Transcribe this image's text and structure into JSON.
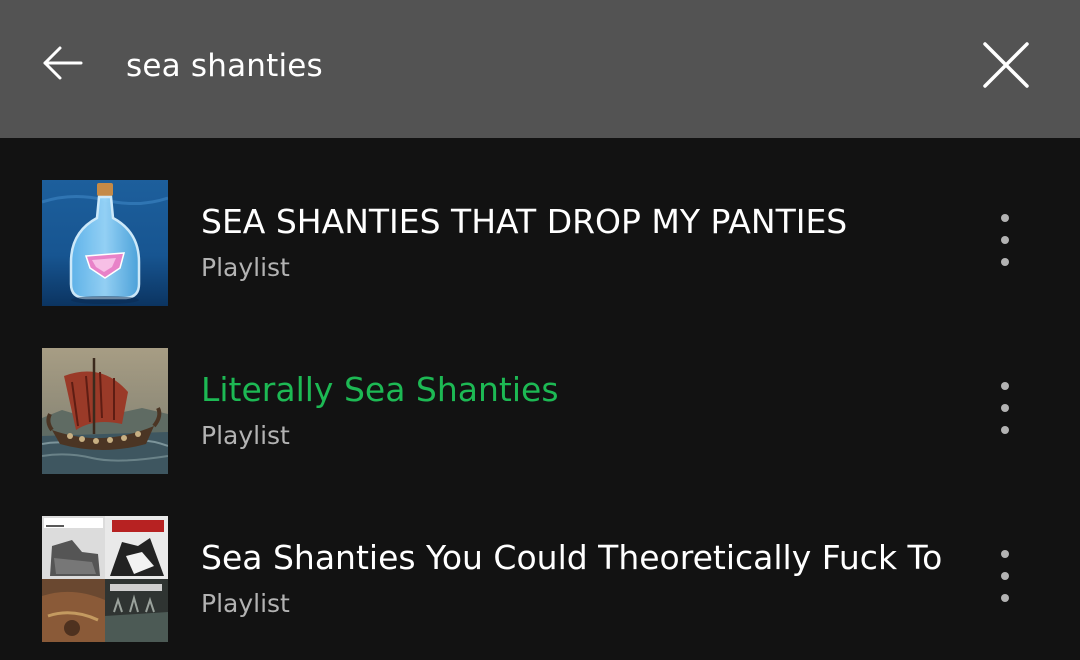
{
  "search": {
    "query": "sea shanties"
  },
  "icons": {
    "back": "arrow-left-icon",
    "clear": "close-icon",
    "more": "more-vertical-icon"
  },
  "colors": {
    "header_bg": "#535353",
    "page_bg": "#121212",
    "accent": "#1db954",
    "secondary_text": "#b3b3b3"
  },
  "results": [
    {
      "title": "SEA SHANTIES THAT DROP MY PANTIES",
      "type": "Playlist",
      "highlighted": false
    },
    {
      "title": "Literally Sea Shanties",
      "type": "Playlist",
      "highlighted": true
    },
    {
      "title": "Sea Shanties You Could Theoretically Fuck To",
      "type": "Playlist",
      "highlighted": false
    }
  ]
}
